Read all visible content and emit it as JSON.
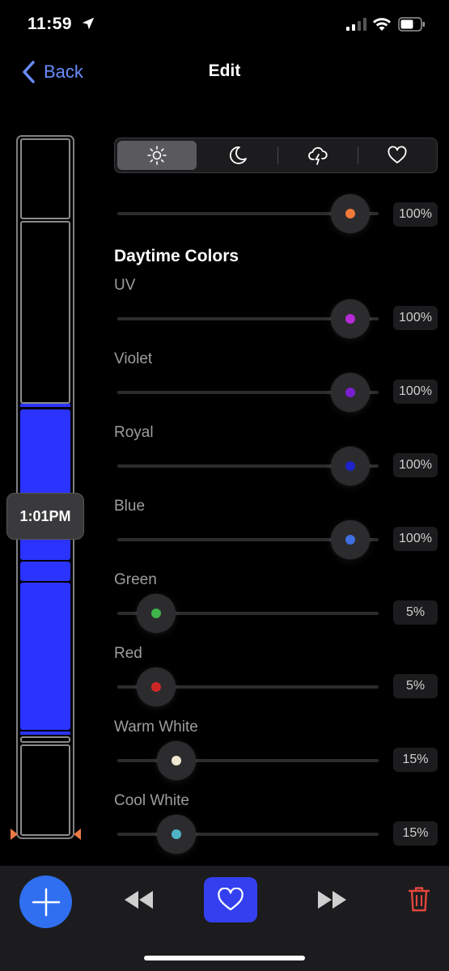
{
  "status_bar": {
    "time": "11:59"
  },
  "nav": {
    "back_label": "Back",
    "title": "Edit"
  },
  "timeline": {
    "current_time": "1:01PM",
    "marker_color": "#e97a45",
    "active_color": "#2b33ff"
  },
  "tabs": [
    {
      "icon": "sun-icon",
      "active": true
    },
    {
      "icon": "moon-icon",
      "active": false
    },
    {
      "icon": "lightning-cloud-icon",
      "active": false
    },
    {
      "icon": "heart-icon",
      "active": false
    }
  ],
  "top_slider": {
    "value": "100%",
    "level": 1.0,
    "color": "#f07a3a"
  },
  "section": {
    "title": "Daytime Colors"
  },
  "channels": [
    {
      "label": "UV",
      "value": "100%",
      "level": 1.0,
      "color": "#b52bd6"
    },
    {
      "label": "Violet",
      "value": "100%",
      "level": 1.0,
      "color": "#7a1fd0"
    },
    {
      "label": "Royal",
      "value": "100%",
      "level": 1.0,
      "color": "#1e24c8"
    },
    {
      "label": "Blue",
      "value": "100%",
      "level": 1.0,
      "color": "#3f6fe0"
    },
    {
      "label": "Green",
      "value": "5%",
      "level": 0.05,
      "color": "#3fb54a"
    },
    {
      "label": "Red",
      "value": "5%",
      "level": 0.05,
      "color": "#cc2727"
    },
    {
      "label": "Warm White",
      "value": "15%",
      "level": 0.15,
      "color": "#efe8d0"
    },
    {
      "label": "Cool White",
      "value": "15%",
      "level": 0.15,
      "color": "#4fb4c8"
    }
  ],
  "toolbar": {
    "add_color": "#2f6ff0",
    "favorite_color": "#3440f0",
    "delete_color": "#e2463b"
  }
}
